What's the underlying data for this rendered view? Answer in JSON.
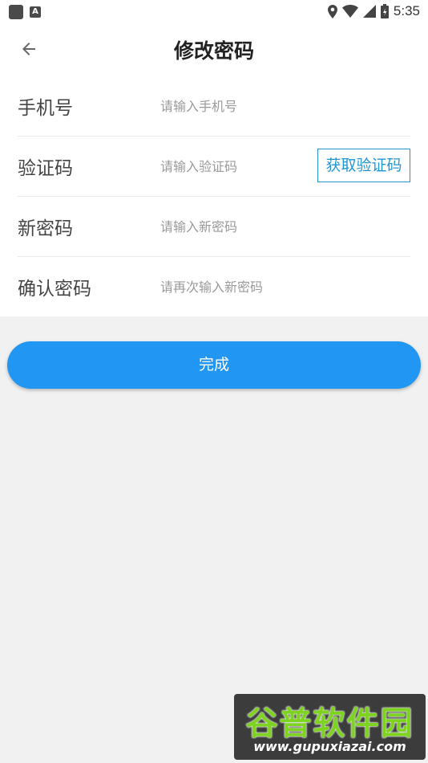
{
  "status_bar": {
    "time": "5:35",
    "left_icons": [
      "app-icon",
      "keyboard-a-icon"
    ],
    "right_icons": [
      "location-icon",
      "wifi-icon",
      "signal-icon",
      "battery-icon"
    ]
  },
  "header": {
    "title": "修改密码",
    "back_icon": "arrow-left-icon"
  },
  "form": {
    "rows": [
      {
        "label": "手机号",
        "placeholder": "请输入手机号",
        "value": ""
      },
      {
        "label": "验证码",
        "placeholder": "请输入验证码",
        "value": "",
        "action": "获取验证码"
      },
      {
        "label": "新密码",
        "placeholder": "请输入新密码",
        "value": ""
      },
      {
        "label": "确认密码",
        "placeholder": "请再次输入新密码",
        "value": ""
      }
    ]
  },
  "submit_label": "完成",
  "watermark": {
    "title": "谷普软件园",
    "url": "www.gupuxiazai.com"
  },
  "colors": {
    "accent": "#2196f3",
    "background": "#f1f1f1",
    "watermark_green": "#7ed321"
  }
}
